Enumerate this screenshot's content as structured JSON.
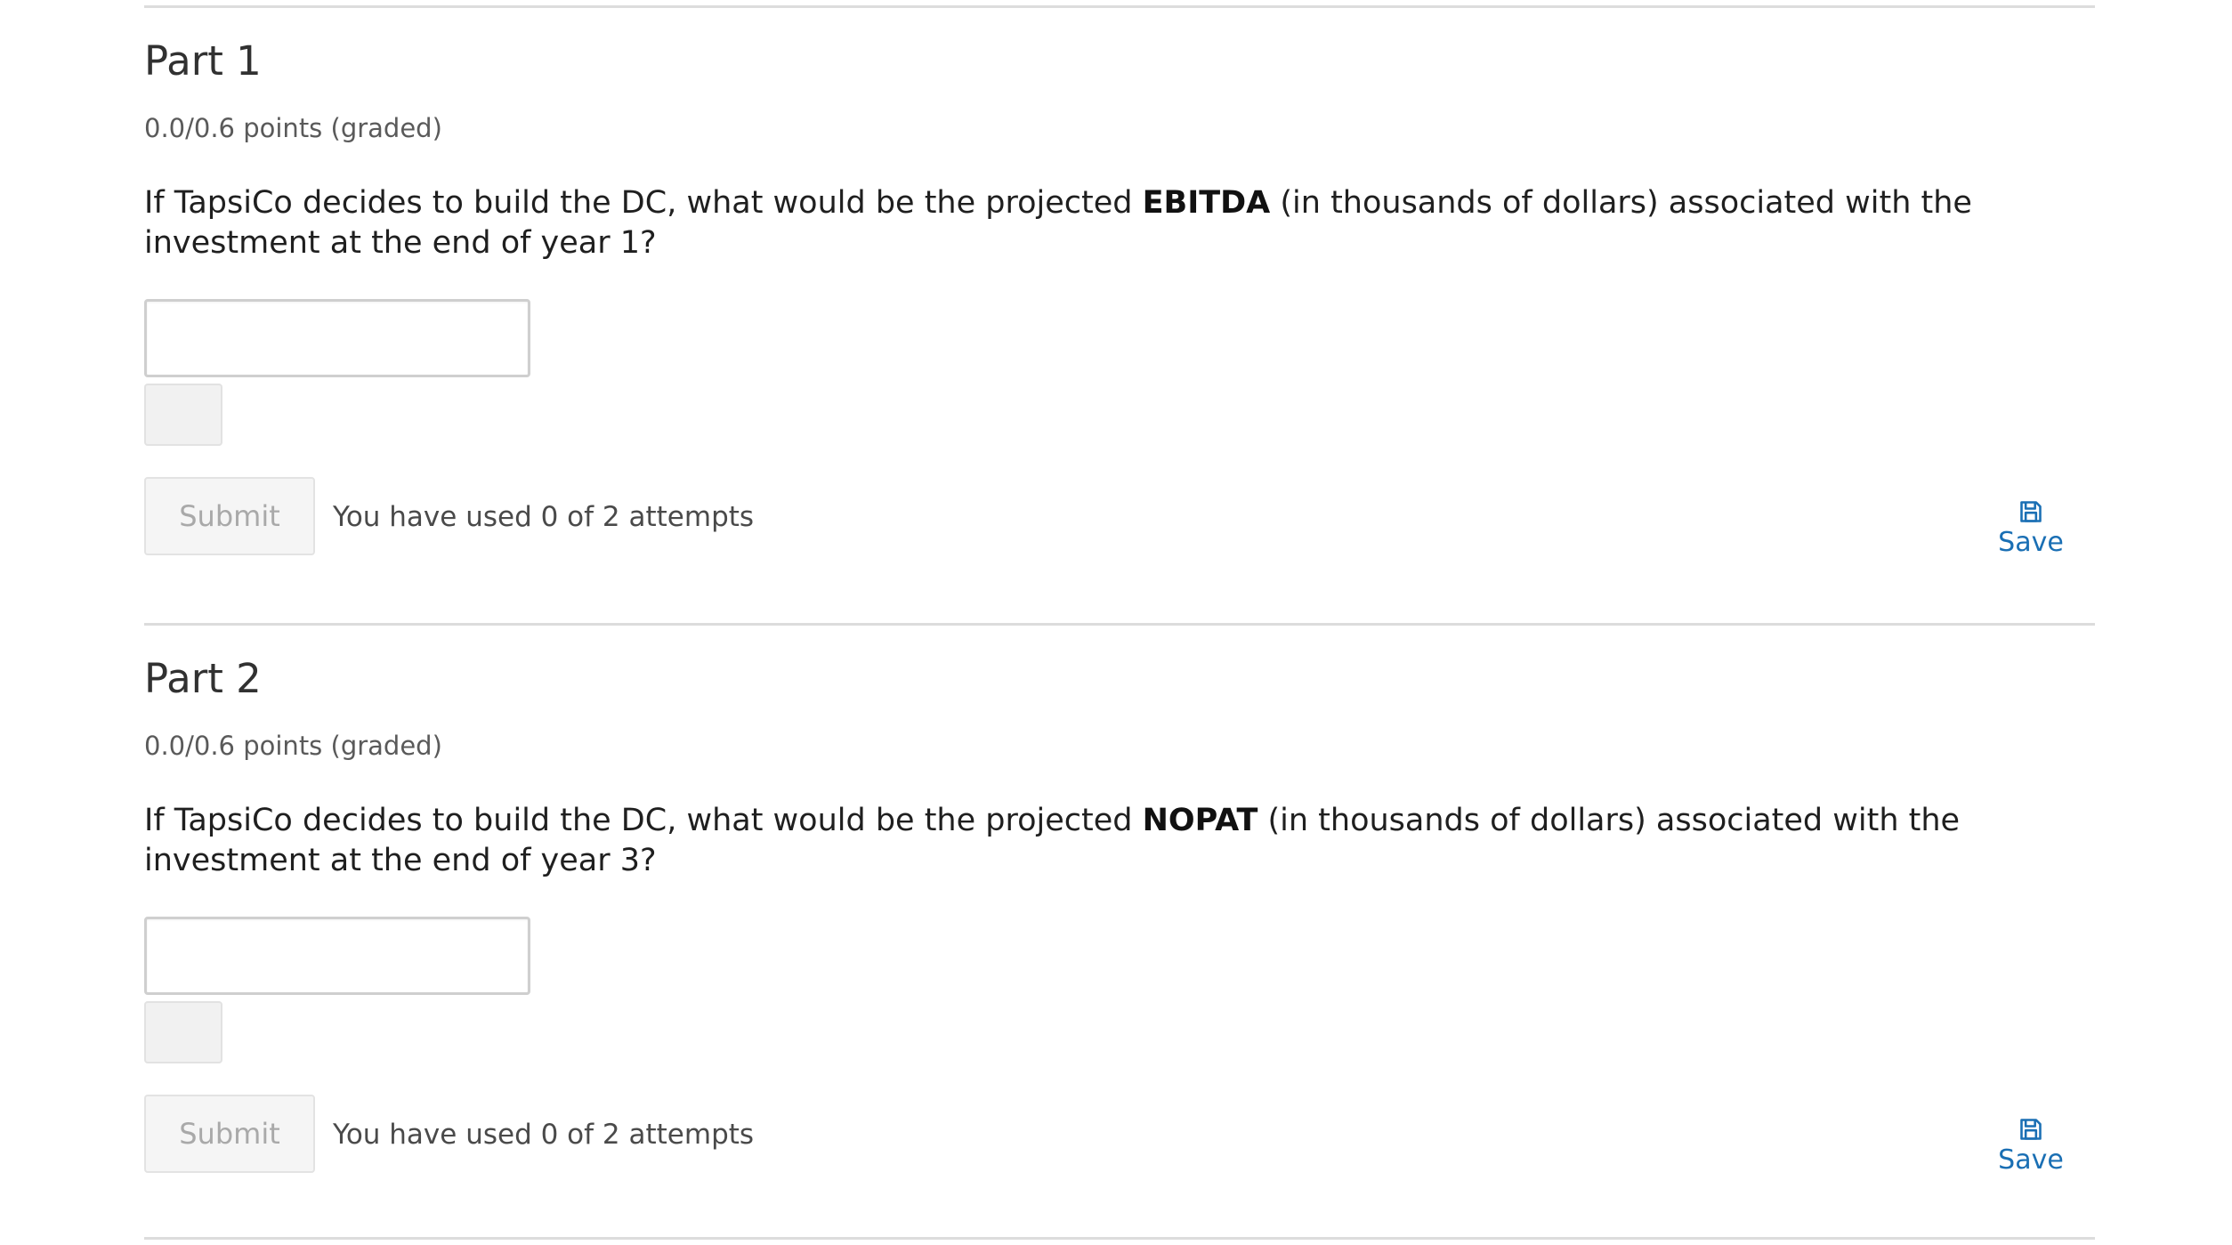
{
  "parts": [
    {
      "title": "Part 1",
      "points": "0.0/0.6 points (graded)",
      "question_before": "If TapsiCo decides to build the DC, what would be the projected ",
      "question_bold": "EBITDA",
      "question_after": " (in thousands of dollars) associated with the investment at the end of year 1?",
      "answer_value": "",
      "submit_label": "Submit",
      "attempts_text": "You have used 0 of 2 attempts",
      "save_label": "Save"
    },
    {
      "title": "Part 2",
      "points": "0.0/0.6 points (graded)",
      "question_before": "If TapsiCo decides to build the DC, what would be the projected ",
      "question_bold": "NOPAT",
      "question_after": " (in thousands of dollars) associated with the investment at the end of year 3?",
      "answer_value": "",
      "submit_label": "Submit",
      "attempts_text": "You have used 0 of 2 attempts",
      "save_label": "Save"
    }
  ],
  "icons": {
    "save": "floppy-disk-icon"
  },
  "colors": {
    "link": "#1a6fb4",
    "divider": "#dcdcdc",
    "disabled_text": "#a9a9a9"
  }
}
